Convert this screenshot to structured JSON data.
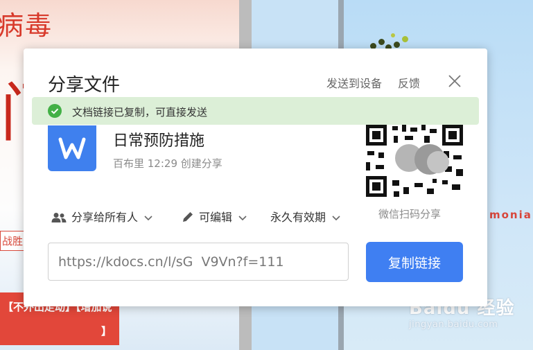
{
  "background": {
    "virus_text": "病毒",
    "big_glyph": "门",
    "victory_text": "战胜",
    "redbox_line1": "【不外出走动】【增加说",
    "redbox_line2": "】",
    "right_text": "monia"
  },
  "watermark": {
    "logo": "Baidu 经验",
    "url": "jingyan.baidu.com"
  },
  "dialog": {
    "title": "分享文件",
    "send_to_device": "发送到设备",
    "feedback": "反馈",
    "toast": "文档链接已复制，可直接发送",
    "file": {
      "name": "日常预防措施",
      "meta": "百布里 12:29 创建分享"
    },
    "qr_label": "微信扫码分享",
    "permissions": {
      "share_scope": "分享给所有人",
      "edit_mode": "可编辑",
      "validity": "永久有效期"
    },
    "link_value": "https://kdocs.cn/l/sG  V9Vn?f=111",
    "copy_button": "复制链接"
  },
  "colors": {
    "accent": "#3f7ff2",
    "success": "#43b046",
    "toast_bg": "#dcefd7"
  },
  "icons": [
    "close-icon",
    "check-circle-icon",
    "wps-writer-icon",
    "users-icon",
    "pencil-icon",
    "chevron-down-icon",
    "qr-code-icon"
  ]
}
